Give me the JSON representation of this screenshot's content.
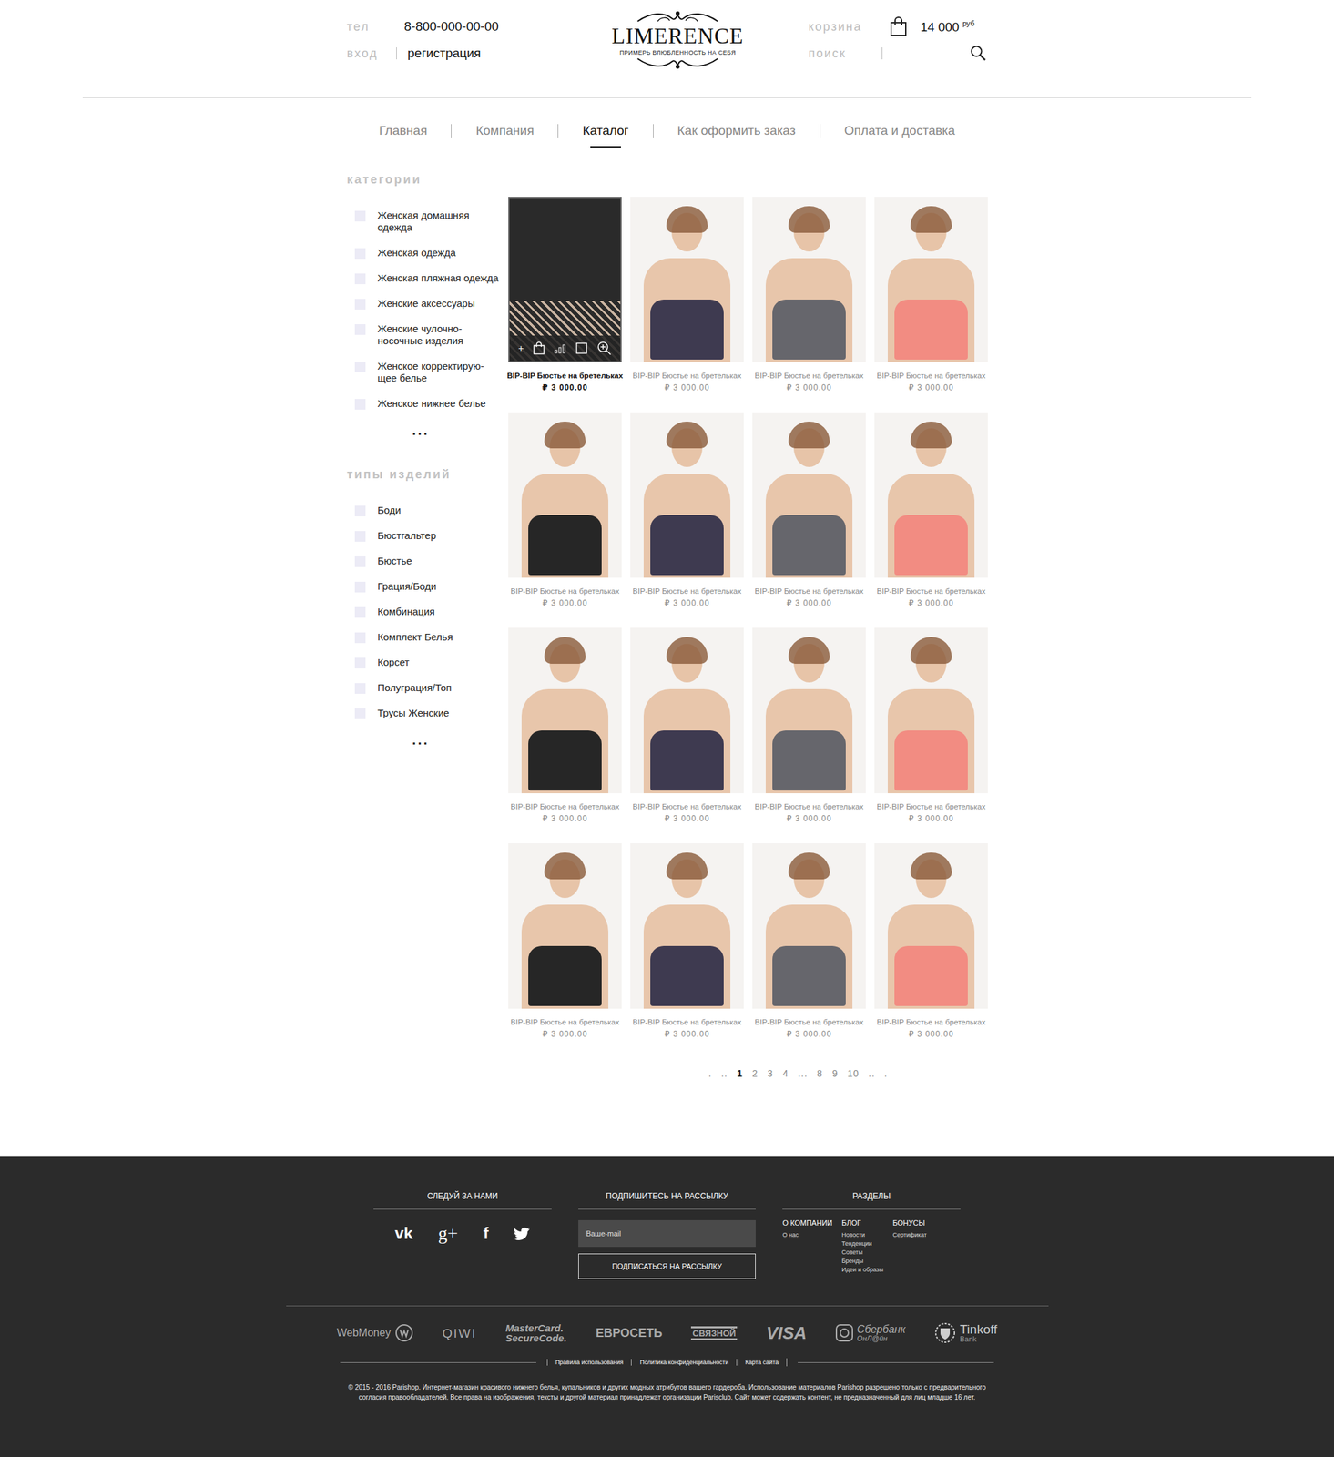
{
  "header": {
    "phone_label": "тел",
    "phone": "8-800-000-00-00",
    "login": "вход",
    "register": "регистрация",
    "logo": "LIMERENCE",
    "tagline": "ПРИМЕРЬ ВЛЮБЛЕННОСТЬ НА СЕБЯ",
    "cart_label": "корзина",
    "cart_total": "14 000",
    "currency": "руб",
    "search_label": "поиск"
  },
  "nav": [
    {
      "label": "Главная",
      "selected": false
    },
    {
      "label": "Компания",
      "selected": false
    },
    {
      "label": "Каталог",
      "selected": true
    },
    {
      "label": "Как оформить заказ",
      "selected": false
    },
    {
      "label": "Оплата и доставка",
      "selected": false
    }
  ],
  "sidebar": {
    "groups": [
      {
        "title": "категории",
        "more": "...",
        "items": [
          {
            "label": "Женская домашняя одежда",
            "checked": false
          },
          {
            "label": "Женская одежда",
            "checked": false
          },
          {
            "label": "Женская пляжная одежда",
            "checked": false
          },
          {
            "label": "Женские аксессуары",
            "checked": false
          },
          {
            "label": "Женские чулочно-носочные изделия",
            "checked": false
          },
          {
            "label": "Женское корректирую-щее белье",
            "checked": false
          },
          {
            "label": "Женское нижнее белье",
            "checked": false
          }
        ]
      },
      {
        "title": "типы изделий",
        "more": "...",
        "items": [
          {
            "label": "Боди",
            "checked": false
          },
          {
            "label": "Бюстгальтер",
            "checked": false
          },
          {
            "label": "Бюстье",
            "checked": false
          },
          {
            "label": "Грация/Боди",
            "checked": false
          },
          {
            "label": "Комбинация",
            "checked": false
          },
          {
            "label": "Комплект Белья",
            "checked": false
          },
          {
            "label": "Корсет",
            "checked": false
          },
          {
            "label": "Полуграция/Топ",
            "checked": false
          },
          {
            "label": "Трусы Женские",
            "checked": false
          }
        ]
      }
    ]
  },
  "product_overlay": {
    "plus": "+"
  },
  "products": [
    {
      "name": "BIP-BIP Бюстье на бретельках",
      "price": "₽ 3 000.00",
      "selected": true,
      "kind": "closeup",
      "color": "#2a2a2a"
    },
    {
      "name": "BIP-BIP Бюстье на бретельках",
      "price": "₽ 3 000.00",
      "selected": false,
      "kind": "model",
      "color": "#3e3a50"
    },
    {
      "name": "BIP-BIP Бюстье на бретельках",
      "price": "₽ 3 000.00",
      "selected": false,
      "kind": "model",
      "color": "#66666c"
    },
    {
      "name": "BIP-BIP Бюстье на бретельках",
      "price": "₽ 3 000.00",
      "selected": false,
      "kind": "model",
      "color": "#f28c82"
    },
    {
      "name": "BIP-BIP Бюстье на бретельках",
      "price": "₽ 3 000.00",
      "selected": false,
      "kind": "model",
      "color": "#262626"
    },
    {
      "name": "BIP-BIP Бюстье на бретельках",
      "price": "₽ 3 000.00",
      "selected": false,
      "kind": "model",
      "color": "#3e3a50"
    },
    {
      "name": "BIP-BIP Бюстье на бретельках",
      "price": "₽ 3 000.00",
      "selected": false,
      "kind": "model",
      "color": "#66666c"
    },
    {
      "name": "BIP-BIP Бюстье на бретельках",
      "price": "₽ 3 000.00",
      "selected": false,
      "kind": "model",
      "color": "#f28c82"
    },
    {
      "name": "BIP-BIP Бюстье на бретельках",
      "price": "₽ 3 000.00",
      "selected": false,
      "kind": "model",
      "color": "#262626"
    },
    {
      "name": "BIP-BIP Бюстье на бретельках",
      "price": "₽ 3 000.00",
      "selected": false,
      "kind": "model",
      "color": "#3e3a50"
    },
    {
      "name": "BIP-BIP Бюстье на бретельках",
      "price": "₽ 3 000.00",
      "selected": false,
      "kind": "model",
      "color": "#66666c"
    },
    {
      "name": "BIP-BIP Бюстье на бретельках",
      "price": "₽ 3 000.00",
      "selected": false,
      "kind": "model",
      "color": "#f28c82"
    },
    {
      "name": "BIP-BIP Бюстье на бретельках",
      "price": "₽ 3 000.00",
      "selected": false,
      "kind": "model",
      "color": "#262626"
    },
    {
      "name": "BIP-BIP Бюстье на бретельках",
      "price": "₽ 3 000.00",
      "selected": false,
      "kind": "model",
      "color": "#3e3a50"
    },
    {
      "name": "BIP-BIP Бюстье на бретельках",
      "price": "₽ 3 000.00",
      "selected": false,
      "kind": "model",
      "color": "#66666c"
    },
    {
      "name": "BIP-BIP Бюстье на бретельках",
      "price": "₽ 3 000.00",
      "selected": false,
      "kind": "model",
      "color": "#f28c82"
    }
  ],
  "pagination": [
    {
      "label": ".",
      "selected": false
    },
    {
      "label": "..",
      "selected": false
    },
    {
      "label": "1",
      "selected": true
    },
    {
      "label": "2",
      "selected": false
    },
    {
      "label": "3",
      "selected": false
    },
    {
      "label": "4",
      "selected": false
    },
    {
      "label": "...",
      "selected": false
    },
    {
      "label": "8",
      "selected": false
    },
    {
      "label": "9",
      "selected": false
    },
    {
      "label": "10",
      "selected": false
    },
    {
      "label": "..",
      "selected": false
    },
    {
      "label": ".",
      "selected": false
    }
  ],
  "footer": {
    "social": {
      "title": "СЛЕДУЙ ЗА НАМИ",
      "items": [
        {
          "kind": "glyph",
          "glyph": "vk"
        },
        {
          "kind": "glyph",
          "glyph": "g+"
        },
        {
          "kind": "glyph",
          "glyph": "f"
        },
        {
          "kind": "bird"
        }
      ]
    },
    "subscribe": {
      "title": "ПОДПИШИТЕСЬ НА РАССЫЛКУ",
      "placeholder": "Ваше-mail",
      "button": "ПОДПИСАТЬСЯ НА РАССЫЛКУ"
    },
    "sections": {
      "title": "РАЗДЕЛЫ",
      "columns": [
        {
          "title": "О КОМПАНИИ",
          "links": [
            "О нас"
          ]
        },
        {
          "title": "БЛОГ",
          "links": [
            "Новости",
            "Тенденции",
            "Советы",
            "Бренды",
            "Идеи и образы"
          ]
        },
        {
          "title": "БОНУСЫ",
          "links": [
            "Сертификат"
          ]
        }
      ]
    },
    "payments": [
      {
        "kind": "webmoney",
        "name": "WebMoney"
      },
      {
        "kind": "qiwi",
        "name": "QIWI"
      },
      {
        "kind": "mastercard",
        "name": "MasterCard.",
        "sub": "SecureCode."
      },
      {
        "kind": "evroset",
        "name": "ЕВРОСЕТЬ"
      },
      {
        "kind": "svyaznoy",
        "name": "СВЯЗНОЙ"
      },
      {
        "kind": "visa",
        "name": "VISA"
      },
      {
        "kind": "sber",
        "name": "Сбербанк",
        "sub": "ОнЛ@йн"
      },
      {
        "kind": "tinkoff",
        "name": "Tinkoff",
        "sub": "Bank"
      }
    ],
    "links": [
      "Правила использования",
      "Политика конфиденциальности",
      "Карта сайта"
    ],
    "copyright": "© 2015 - 2016 Parishop. Интернет-магазин красивого нижнего белья, купальников и других модных атрибутов вашего гардероба. Использование материалов Parishop разрешено только с предварительного согласия правообладателей. Все права на изображения, тексты и другой материал принадлежат организации Parisclub. Сайт может содержать контент, не предназначенный для лиц младше 16 лет."
  }
}
